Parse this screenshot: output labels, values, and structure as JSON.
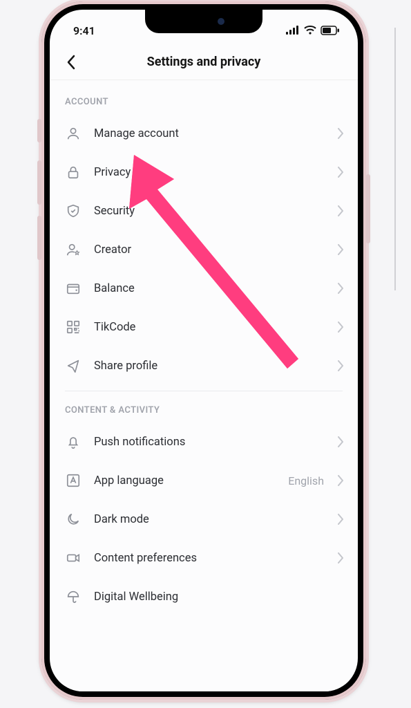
{
  "status": {
    "time": "9:41"
  },
  "header": {
    "title": "Settings and privacy"
  },
  "sections": [
    {
      "title": "ACCOUNT",
      "items": [
        {
          "icon": "person-icon",
          "label": "Manage account"
        },
        {
          "icon": "lock-icon",
          "label": "Privacy"
        },
        {
          "icon": "shield-icon",
          "label": "Security"
        },
        {
          "icon": "star-user-icon",
          "label": "Creator"
        },
        {
          "icon": "wallet-icon",
          "label": "Balance"
        },
        {
          "icon": "qr-icon",
          "label": "TikCode"
        },
        {
          "icon": "share-icon",
          "label": "Share profile"
        }
      ]
    },
    {
      "title": "CONTENT & ACTIVITY",
      "items": [
        {
          "icon": "bell-icon",
          "label": "Push notifications"
        },
        {
          "icon": "language-icon",
          "label": "App language",
          "value": "English"
        },
        {
          "icon": "moon-icon",
          "label": "Dark mode"
        },
        {
          "icon": "video-icon",
          "label": "Content preferences"
        },
        {
          "icon": "umbrella-icon",
          "label": "Digital Wellbeing"
        }
      ]
    }
  ]
}
